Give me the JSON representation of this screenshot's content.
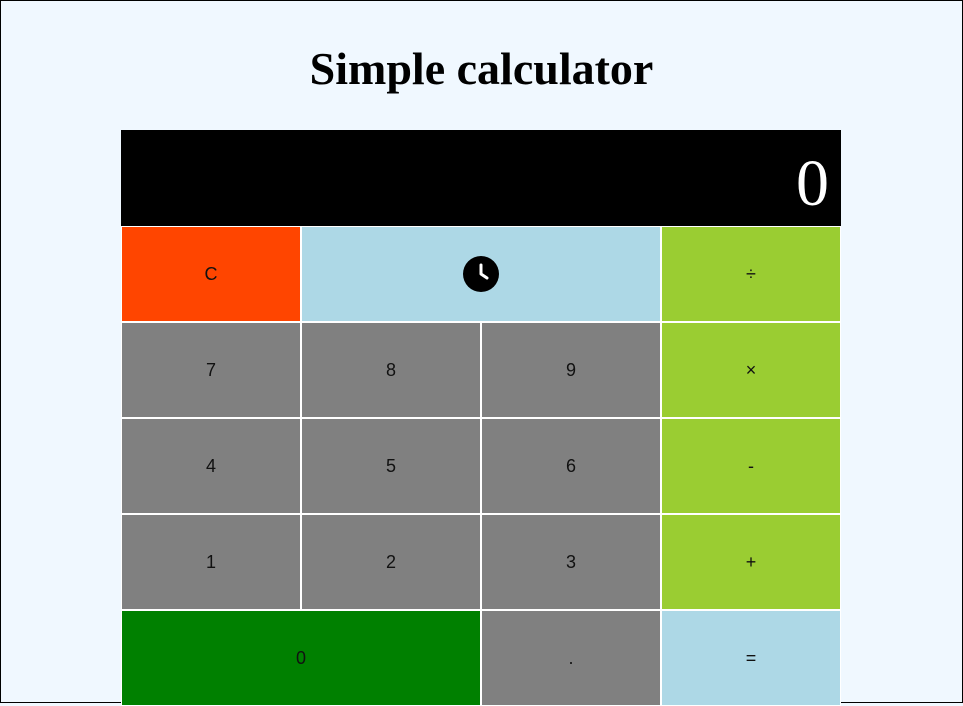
{
  "page": {
    "title": "Simple calculator"
  },
  "display": {
    "value": "0"
  },
  "keys": {
    "clear": "C",
    "history_icon": "clock-icon",
    "divide": "÷",
    "seven": "7",
    "eight": "8",
    "nine": "9",
    "multiply": "×",
    "four": "4",
    "five": "5",
    "six": "6",
    "subtract": "-",
    "one": "1",
    "two": "2",
    "three": "3",
    "add": "+",
    "zero": "0",
    "decimal": ".",
    "equals": "="
  },
  "colors": {
    "page_background": "#f0f8ff",
    "display_background": "#000000",
    "display_text": "#ffffff",
    "clear_key": "#ff4500",
    "history_key": "#add8e6",
    "operator_key": "#9acd32",
    "number_key": "#808080",
    "zero_key": "#008000",
    "equals_key": "#add8e6"
  }
}
